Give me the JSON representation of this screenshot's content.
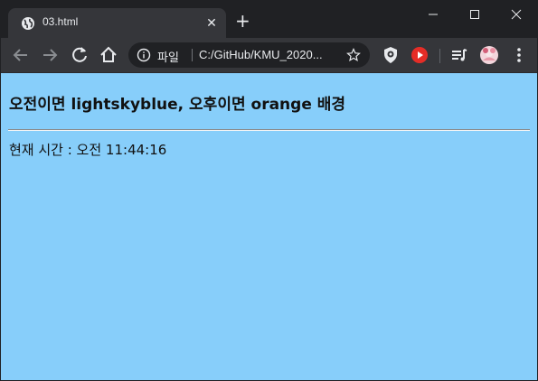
{
  "tab": {
    "title": "03.html",
    "close_glyph": "✕",
    "favicon_icon": "globe-icon"
  },
  "new_tab": {
    "glyph": "+"
  },
  "window_controls": {
    "minimize_icon": "minimize-icon",
    "maximize_icon": "maximize-icon",
    "close_icon": "close-icon"
  },
  "toolbar": {
    "back_icon": "arrow-left-icon",
    "forward_icon": "arrow-right-icon",
    "reload_icon": "reload-icon",
    "home_icon": "home-icon"
  },
  "omnibox": {
    "security_label": "파일",
    "url": "C:/GitHub/KMU_2020...",
    "info_icon": "info-icon",
    "star_icon": "star-icon"
  },
  "extensions": {
    "icons": [
      "extension-shield-icon",
      "youtube-icon",
      "media-queue-icon",
      "profile-avatar-icon",
      "more-vertical-icon"
    ]
  },
  "page": {
    "background_color": "#87cefa",
    "heading": "오전이면 lightskyblue, 오후이면 orange 배경",
    "time_text": "현재 시간 : 오전 11:44:16"
  }
}
